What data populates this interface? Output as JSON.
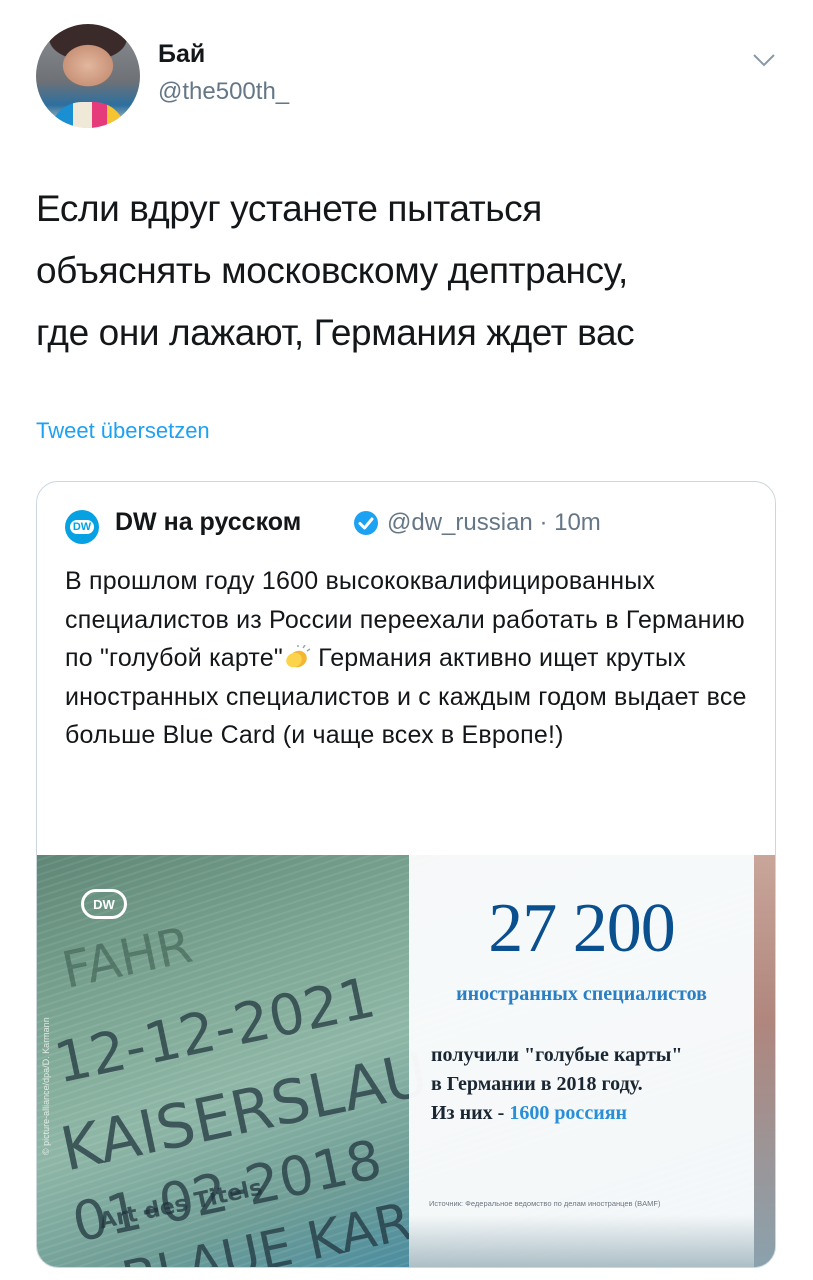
{
  "user": {
    "display_name": "Бай",
    "handle": "@the500th_"
  },
  "tweet": {
    "text": "Если вдруг устанете пытаться\nобъяснять московскому дептрансу,\nгде они лажают, Германия ждет вас",
    "translate_link": "Tweet übersetzen"
  },
  "quote": {
    "badge_label": "DW",
    "author_name": "DW на русском",
    "author_handle": "@dw_russian",
    "separator": "·",
    "timestamp": "10m",
    "text_before_emoji": "В прошлом году 1600 высококвалифицированных специалистов из России переехали работать в Германию по \"голубой карте\"",
    "text_after_emoji": " Германия активно ищет крутых иностранных специалистов и с каждым годом выдает все больше Blue Card (и чаще всех в Европе!)"
  },
  "media": {
    "logo_label": "DW",
    "photo_lines": [
      "12-12-2021",
      "KAISERSLAU",
      "01-02-2018",
      "Art des Titels",
      "BLAUE KAR",
      "FAHR"
    ],
    "photo_credit": "© picture-alliance/dpa/D. Karmann",
    "stat_number": "27 200",
    "stat_label": "иностранных специалистов",
    "stat_line1": "получили \"голубые карты\"",
    "stat_line2": "в Германии в 2018 году.",
    "stat_line3_prefix": "Из них - ",
    "stat_line3_highlight": "1600 россиян",
    "source": "Источник: Федеральное ведомство по делам иностранцев (BAMF)"
  },
  "colors": {
    "link": "#1da1f2",
    "verified": "#1da1f2",
    "dw_blue": "#05a1e3",
    "stat_number": "#0a4f8e"
  },
  "icons": [
    "chevron-down-icon",
    "verified-badge-icon",
    "clapping-hands-emoji",
    "dw-logo"
  ]
}
